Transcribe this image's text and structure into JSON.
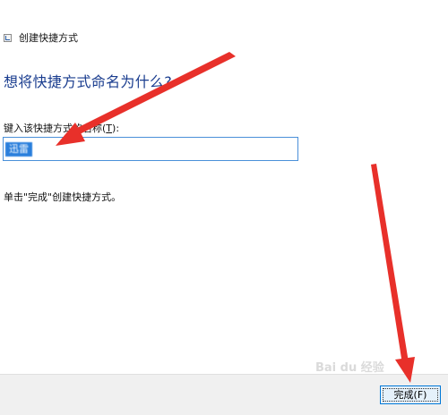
{
  "window": {
    "title": "创建快捷方式",
    "icon": "shortcut-icon"
  },
  "main": {
    "heading": "想将快捷方式命名为什么?",
    "field_label_prefix": "键入该快捷方式的名称(",
    "field_label_key": "T",
    "field_label_suffix": "):",
    "name_value": "迅雷",
    "hint": "单击\"完成\"创建快捷方式。"
  },
  "footer": {
    "finish_label": "完成(F)"
  },
  "annotations": {
    "arrow_color": "#e8302a",
    "watermark": "Bai du 经验"
  },
  "colors": {
    "heading": "#1a3d8f",
    "input_border": "#4a90d9",
    "selection": "#2a7fdc",
    "footer_bg": "#f0f0f0",
    "button_border": "#0078d7"
  }
}
